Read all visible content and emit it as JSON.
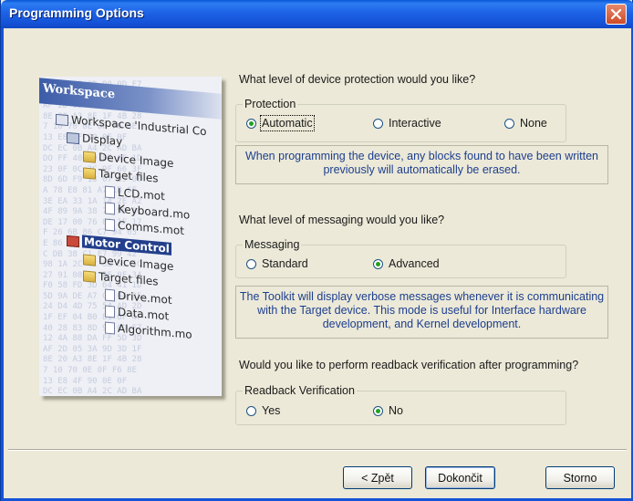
{
  "window": {
    "title": "Programming Options"
  },
  "illustration": {
    "header": "Workspace",
    "hex_lines": [
      "40 28 83 8D 90 0D F7",
      "12 4A 88 DA FF 5D 3D",
      "AF 2D 05 3A 9D 3D 1F",
      "8E 20 A3 8E 1F 4B 28",
      "7 10 70 0E 0F F6 8E",
      "13 E8 4F 90 0E 0F",
      "DC EC 0B A4 2C AD BA",
      "DO FF 40 DO 0E 0E 1D",
      "23 0F 0C 3C 9F 66 3F",
      "8D 6D F9 13 07 89 00",
      "A 78 E8 81 A7 1B 6F",
      "3E EA 33 1A 14 2E A2",
      "4F 89 9A 38 7E 5D 8C",
      "DE 17 00 76 01 1F 17",
      "F 26 6B 86 C7 94 03",
      "E 86 43 EE 8B 51 B7",
      "C DB 38 C1 F7 99 42",
      "98 1A 2C 4C 3E 51 5C",
      "27 91 08 42 0E 0F 34",
      "F0 58 FD 3D 64 41 1D",
      "5D 9A DE A7 C5 64 85",
      "24 D4 4D 75 54 AD 2D",
      "1F EF 04 B0 81 6F 4F",
      "40 28 83 8D 90 0D F7",
      "12 4A 88 DA FF 5D 3D",
      "AF 2D 05 3A 9D 3D 1F",
      "8E 20 A3 8E 1F 4B 28",
      "7 10 70 0E 0F F6 8E",
      "13 E8 4F 90 0E 0F",
      "DC EC 0B A4 2C AD BA"
    ],
    "tree": {
      "workspace": "Workspace 'Industrial Co",
      "display": "Display",
      "device_image_1": "Device Image",
      "target_files_1": "Target files",
      "lcd": "LCD.mot",
      "keyboard": "Keyboard.mo",
      "comms": "Comms.mot",
      "motor_control": "Motor Control",
      "device_image_2": "Device Image",
      "target_files_2": "Target files",
      "drive": "Drive.mot",
      "data": "Data.mot",
      "algorithm": "Algorithm.mo"
    }
  },
  "protection": {
    "question": "What level of device protection would you like?",
    "group_label": "Protection",
    "options": [
      "Automatic",
      "Interactive",
      "None"
    ],
    "selected": "Automatic",
    "info": "When programming the device, any blocks found to have been written previously will automatically be erased."
  },
  "messaging": {
    "question": "What level of messaging would you like?",
    "group_label": "Messaging",
    "options": [
      "Standard",
      "Advanced"
    ],
    "selected": "Advanced",
    "info": "The Toolkit will display verbose messages whenever it is communicating with the Target device. This mode is useful for Interface hardware development, and Kernel development."
  },
  "verification": {
    "question": "Would you like to perform readback verification after programming?",
    "group_label": "Readback Verification",
    "options": [
      "Yes",
      "No"
    ],
    "selected": "No"
  },
  "buttons": {
    "back": "< Zpět",
    "finish": "Dokončit",
    "cancel": "Storno"
  },
  "colors": {
    "title_bar": "#1553d8",
    "close_button": "#d9532e",
    "info_text": "#1d3f8f",
    "radio_checked": "#21a121"
  }
}
